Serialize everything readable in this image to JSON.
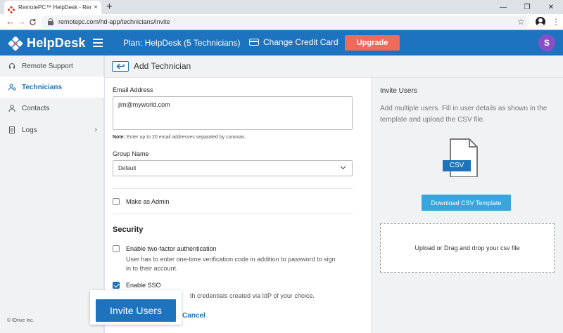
{
  "browser": {
    "tab_title": "RemotePC™ HelpDesk - Remote",
    "tab_close": "×",
    "new_tab": "+",
    "url": "remotepc.com/hd-app/technicians/invite",
    "back": "←",
    "forward": "→",
    "reload": "C",
    "star": "☆",
    "menu": "⋮",
    "minimize": "—",
    "restore": "❐",
    "close": "✕"
  },
  "header": {
    "logo_text": "HelpDesk",
    "plan": "Plan: HelpDesk (5 Technicians)",
    "change_card": "Change Credit Card",
    "upgrade": "Upgrade",
    "avatar_initial": "S"
  },
  "sidebar": {
    "items": [
      {
        "label": "Remote Support",
        "icon": "headset-icon"
      },
      {
        "label": "Technicians",
        "icon": "technicians-icon"
      },
      {
        "label": "Contacts",
        "icon": "person-icon"
      },
      {
        "label": "Logs",
        "icon": "log-icon"
      }
    ],
    "logs_arrow": "›",
    "copyright": "© IDrive Inc."
  },
  "page": {
    "title": "Add Technician"
  },
  "form": {
    "email_label": "Email Address",
    "email_value": "jim@myworld.com",
    "note_prefix": "Note:",
    "note_text": " Enter up to 20 email addresses separated by commas.",
    "group_label": "Group Name",
    "group_value": "Default",
    "make_admin": "Make as Admin",
    "security_title": "Security",
    "two_factor_label": "Enable two-factor authentication",
    "two_factor_help": "User has to enter one-time verification code in addition to password to sign in to their  account.",
    "sso_label": "Enable SSO",
    "sso_help": "th credentials created via IdP of your choice.",
    "invite_button": "Invite Users",
    "cancel": "Cancel",
    "make_admin_checked": false,
    "two_factor_checked": false,
    "sso_checked": true
  },
  "right_panel": {
    "title": "Invite Users",
    "description": "Add multiple users. Fill in user details as shown in the template and upload the CSV file.",
    "csv_badge": "CSV",
    "download_button": "Download CSV Template",
    "dropzone_text": "Upload or Drag and drop your csv file"
  },
  "colors": {
    "brand_blue": "#1e73be",
    "upgrade_red": "#ef6a5a",
    "avatar_purple": "#8a4ec9",
    "download_blue": "#3aa5dc"
  }
}
